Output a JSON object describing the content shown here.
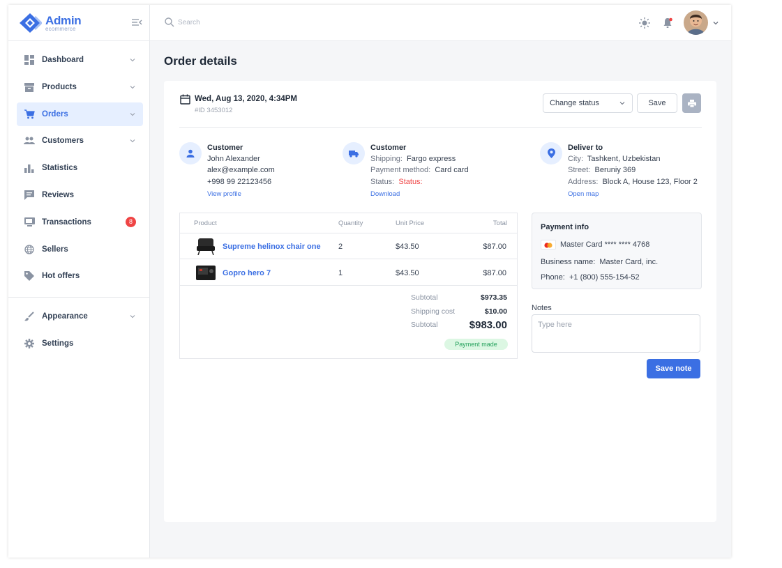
{
  "brand": {
    "title": "Admin",
    "subtitle": "ecommerce"
  },
  "sidebar": {
    "items": [
      {
        "label": "Dashboard",
        "icon": "dashboard-icon",
        "chevron": true
      },
      {
        "label": "Products",
        "icon": "archive-icon",
        "chevron": true
      },
      {
        "label": "Orders",
        "icon": "cart-icon",
        "chevron": true,
        "active": true
      },
      {
        "label": "Customers",
        "icon": "people-icon",
        "chevron": true
      },
      {
        "label": "Statistics",
        "icon": "bar-chart-icon"
      },
      {
        "label": "Reviews",
        "icon": "comment-icon"
      },
      {
        "label": "Transactions",
        "icon": "monitor-icon",
        "badge": "8"
      },
      {
        "label": "Sellers",
        "icon": "globe-icon"
      },
      {
        "label": "Hot offers",
        "icon": "tag-icon"
      }
    ],
    "items2": [
      {
        "label": "Appearance",
        "icon": "brush-icon",
        "chevron": true
      },
      {
        "label": "Settings",
        "icon": "gear-icon"
      }
    ]
  },
  "topbar": {
    "search_placeholder": "Search"
  },
  "page": {
    "title": "Order details"
  },
  "order": {
    "date": "Wed, Aug 13, 2020, 4:34PM",
    "id": "#ID 3453012",
    "status_select": "Change status",
    "save_label": "Save"
  },
  "customer": {
    "title": "Customer",
    "name": "John Alexander",
    "email": "alex@example.com",
    "phone": "+998 99 22123456",
    "link": "View profile"
  },
  "shipping": {
    "title": "Customer",
    "shipping_key": "Shipping:",
    "shipping_val": "Fargo express",
    "payment_key": "Payment method:",
    "payment_val": "Card card",
    "status_key": "Status:",
    "status_val": "Status:",
    "link": "Download"
  },
  "deliver": {
    "title": "Deliver to",
    "city_key": "City:",
    "city_val": "Tashkent, Uzbekistan",
    "street_key": "Street:",
    "street_val": "Beruniy 369",
    "address_key": "Address:",
    "address_val": "Block A, House 123, Floor 2",
    "link": "Open map"
  },
  "table": {
    "headers": {
      "product": "Product",
      "quantity": "Quantity",
      "unit_price": "Unit Price",
      "total": "Total"
    },
    "rows": [
      {
        "product": "Supreme helinox chair one",
        "quantity": "2",
        "unit_price": "$43.50",
        "total": "$87.00"
      },
      {
        "product": "Gopro hero 7",
        "quantity": "1",
        "unit_price": "$43.50",
        "total": "$87.00"
      }
    ],
    "summary": {
      "subtotal_label": "Subtotal",
      "subtotal": "$973.35",
      "shipping_label": "Shipping cost",
      "shipping": "$10.00",
      "grand_label": "Subtotal",
      "grand": "$983.00",
      "badge": "Payment made"
    }
  },
  "payment": {
    "title": "Payment info",
    "card": "Master Card **** **** 4768",
    "business_key": "Business name:",
    "business_val": "Master Card, inc.",
    "phone_key": "Phone:",
    "phone_val": "+1 (800) 555-154-52"
  },
  "notes": {
    "label": "Notes",
    "placeholder": "Type here",
    "button": "Save note"
  },
  "colors": {
    "accent": "#3b6fe3",
    "danger": "#ef4444",
    "success": "#22a05a"
  }
}
